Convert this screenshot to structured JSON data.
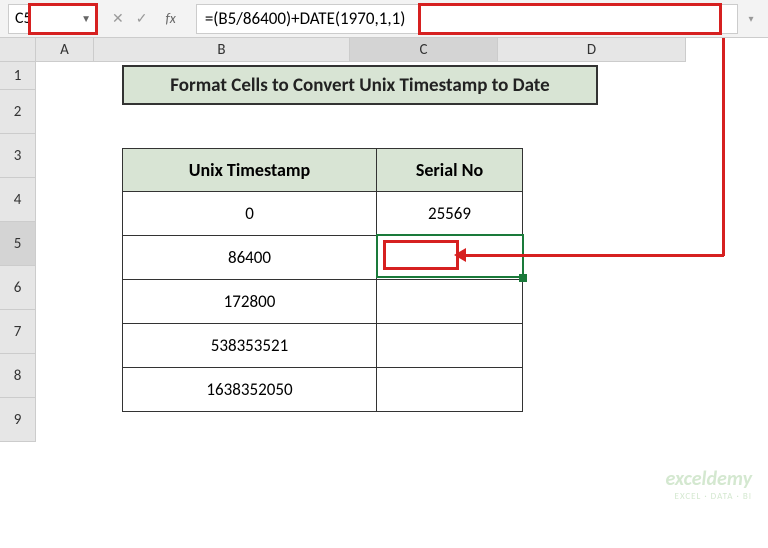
{
  "formula_bar": {
    "cell_ref": "C5",
    "fx_label": "fx",
    "formula": "=(B5/86400)+DATE(1970,1,1)"
  },
  "columns": {
    "A": "A",
    "B": "B",
    "C": "C",
    "D": "D"
  },
  "rows": {
    "1": "1",
    "2": "2",
    "3": "3",
    "4": "4",
    "5": "5",
    "6": "6",
    "7": "7",
    "8": "8",
    "9": "9"
  },
  "title": "Format Cells to Convert Unix Timestamp to Date",
  "table": {
    "headers": {
      "col1": "Unix Timestamp",
      "col2": "Serial No"
    },
    "rows": [
      {
        "timestamp": "0",
        "serial": "25569"
      },
      {
        "timestamp": "86400",
        "serial": ""
      },
      {
        "timestamp": "172800",
        "serial": ""
      },
      {
        "timestamp": "538353521",
        "serial": ""
      },
      {
        "timestamp": "1638352050",
        "serial": ""
      }
    ]
  },
  "watermark": {
    "brand": "exceldemy",
    "tagline": "EXCEL · DATA · BI"
  }
}
